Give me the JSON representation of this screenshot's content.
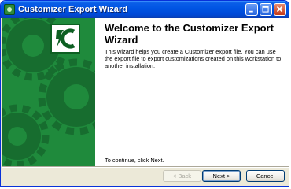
{
  "window": {
    "title": "Customizer Export Wizard",
    "icon": "customizer-app-icon",
    "controls": [
      "minimize-icon",
      "maximize-icon",
      "close-icon"
    ]
  },
  "sidebar": {
    "background": "#1f8a3c",
    "gear_color": "#166b2d",
    "logo_icon": "customizer-logo-icon"
  },
  "main": {
    "heading": "Welcome to the Customizer Export Wizard",
    "description": "This wizard helps you create a Customizer export file. You can use the export file to export customizations created on this workstation to another installation.",
    "continue_hint": "To continue, click Next."
  },
  "buttons": {
    "back": "< Back",
    "next": "Next >",
    "cancel": "Cancel"
  }
}
